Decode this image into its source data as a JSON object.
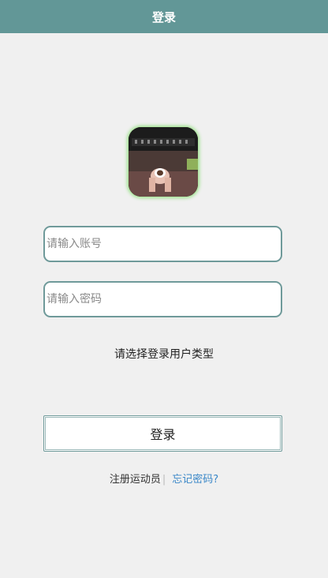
{
  "header": {
    "title": "登录"
  },
  "form": {
    "account_placeholder": "请输入账号",
    "password_placeholder": "请输入密码",
    "user_type_label": "请选择登录用户类型",
    "login_label": "登录"
  },
  "links": {
    "register_label": "注册运动员",
    "separator": "|",
    "forgot_label": "忘记密码?"
  },
  "colors": {
    "header_bg": "#629797",
    "border": "#6f9a9a",
    "link": "#3a87c8",
    "avatar_glow": "#9fe38e"
  }
}
